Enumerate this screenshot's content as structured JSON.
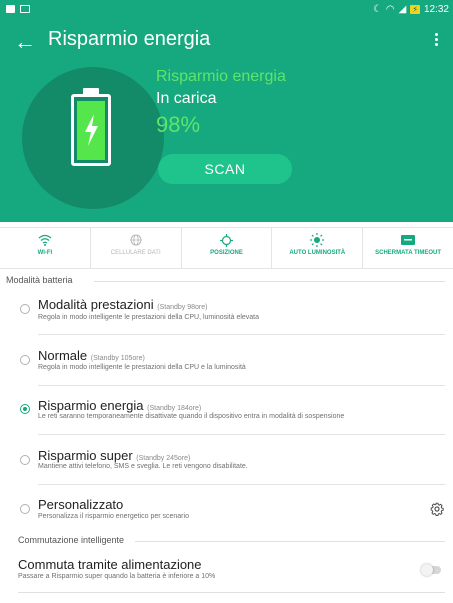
{
  "status_bar": {
    "time": "12:32",
    "battery": "98"
  },
  "header": {
    "title": "Risparmio energia",
    "mode_title": "Risparmio energia",
    "charging_state": "In carica",
    "battery_percent": "98%",
    "scan_label": "SCAN"
  },
  "colors": {
    "primary": "#16a97f",
    "accent": "#5fe46a",
    "battery_fill": "#55e64b",
    "scan": "#1fc48d"
  },
  "quick_settings": [
    {
      "label": "WI-FI",
      "icon": "wifi-icon",
      "active": true
    },
    {
      "label": "CELLULARE DATI",
      "icon": "globe-icon",
      "active": false
    },
    {
      "label": "POSIZIONE",
      "icon": "location-icon",
      "active": true
    },
    {
      "label": "AUTO LUMINOSITÀ",
      "icon": "brightness-icon",
      "active": true
    },
    {
      "label": "SCHERMATA TIMEOUT",
      "icon": "timeout-icon",
      "active": true
    }
  ],
  "sections": {
    "battery_modes": "Modalità batteria",
    "smart_switch": "Commutazione intelligente"
  },
  "modes": [
    {
      "name": "Modalità prestazioni",
      "standby": "(Standby 98ore)",
      "desc": "Regola in modo intelligente le prestazioni della CPU, luminosità elevata",
      "selected": false
    },
    {
      "name": "Normale",
      "standby": "(Standby 105ore)",
      "desc": "Regola in modo intelligente le prestazioni della CPU e la luminosità",
      "selected": false
    },
    {
      "name": "Risparmio energia",
      "standby": "(Standby 184ore)",
      "desc": "Le reti saranno temporaneamente disattivate quando il dispositivo entra in modalità di sospensione",
      "selected": true
    },
    {
      "name": "Risparmio super",
      "standby": "(Standby 245ore)",
      "desc": "Mantiene attivi telefono, SMS e sveglia. Le reti vengono disabilitate.",
      "selected": false
    },
    {
      "name": "Personalizzato",
      "standby": "",
      "desc": "Personalizza il risparmio energetico per scenario",
      "selected": false
    }
  ],
  "switch_setting": {
    "title": "Commuta tramite alimentazione",
    "desc": "Passare a Risparmio super quando la batteria è inferiore a 10%",
    "enabled": false
  }
}
